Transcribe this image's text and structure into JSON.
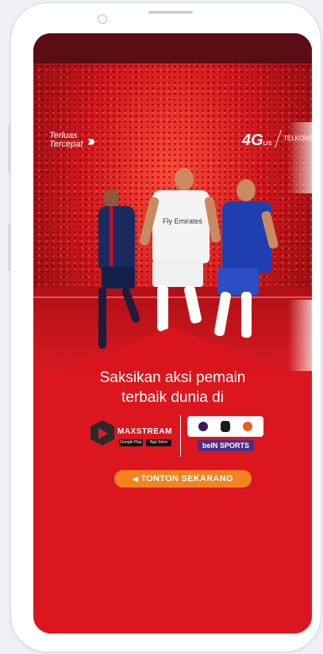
{
  "promo": {
    "brand_tagline_line1": "Terluas",
    "brand_tagline_line2": "Tercepat",
    "network_label": "4G",
    "network_suffix": "LTE",
    "operator_label": "TELKOMSEL",
    "jersey_sponsor": "Fly Emirates",
    "headline_line1": "Saksikan aksi pemain",
    "headline_line2": "terbaik dunia di",
    "app_name": "MAXSTREAM",
    "store_badges": [
      "Google Play",
      "App Store"
    ],
    "broadcaster": "beIN SPORTS",
    "cta_label": "TONTON SEKARANG"
  },
  "colors": {
    "accent": "#d9141c",
    "cta": "#f4821f",
    "bein": "#4a2e86"
  }
}
